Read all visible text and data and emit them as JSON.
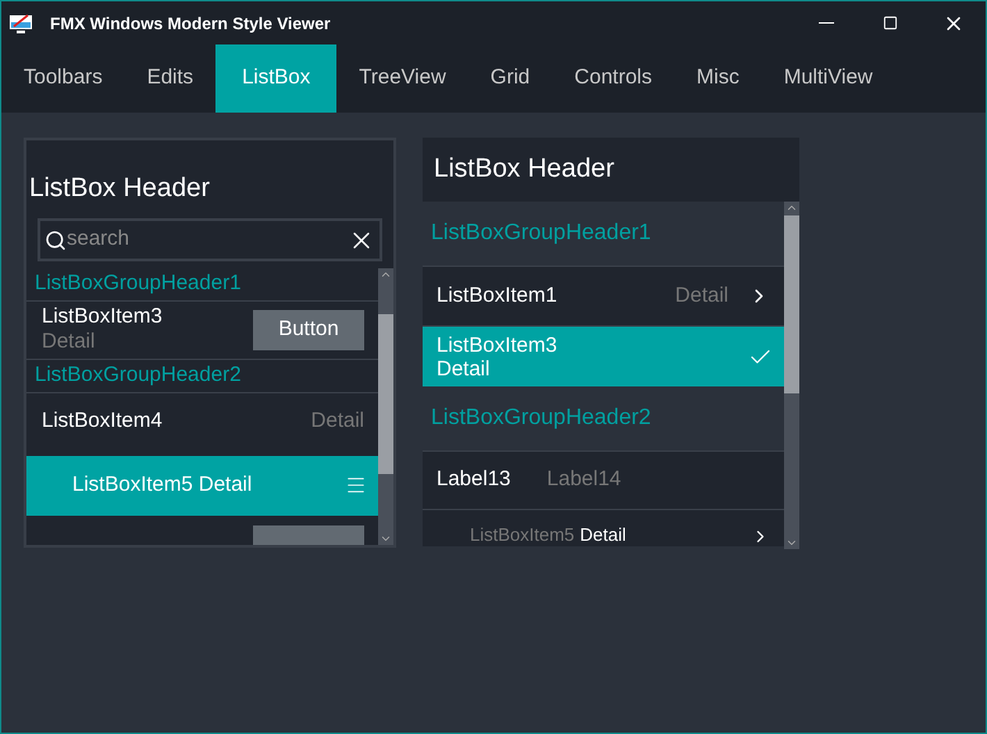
{
  "window": {
    "title": "FMX Windows Modern Style Viewer"
  },
  "tabs": [
    {
      "label": "Toolbars",
      "selected": false
    },
    {
      "label": "Edits",
      "selected": false
    },
    {
      "label": "ListBox",
      "selected": true
    },
    {
      "label": "TreeView",
      "selected": false
    },
    {
      "label": "Grid",
      "selected": false
    },
    {
      "label": "Controls",
      "selected": false
    },
    {
      "label": "Misc",
      "selected": false
    },
    {
      "label": "MultiView",
      "selected": false
    }
  ],
  "left_list": {
    "header": "ListBox Header",
    "search": {
      "placeholder": "search"
    },
    "items": [
      {
        "kind": "group",
        "text": "ListBoxGroupHeader1"
      },
      {
        "kind": "button",
        "text": "ListBoxItem3",
        "detail": "Detail",
        "button": "Button",
        "selected": false
      },
      {
        "kind": "group",
        "text": "ListBoxGroupHeader2"
      },
      {
        "kind": "detail",
        "text": "ListBoxItem4",
        "detail": "Detail",
        "selected": false
      },
      {
        "kind": "menu",
        "text": "ListBoxItem5 Detail",
        "selected": true
      },
      {
        "kind": "partial",
        "selected": false
      }
    ]
  },
  "right_list": {
    "header": "ListBox Header",
    "items": [
      {
        "kind": "group",
        "text": "ListBoxGroupHeader1"
      },
      {
        "kind": "chevron",
        "text": "ListBoxItem1",
        "detail": "Detail",
        "selected": false
      },
      {
        "kind": "check",
        "text": "ListBoxItem3",
        "detail": "Detail",
        "selected": true
      },
      {
        "kind": "group",
        "text": "ListBoxGroupHeader2"
      },
      {
        "kind": "labels",
        "text": "Label13",
        "detail": "Label14",
        "selected": false
      },
      {
        "kind": "cut",
        "text": "ListBoxItem5",
        "detail": "Detail",
        "selected": false
      }
    ]
  }
}
